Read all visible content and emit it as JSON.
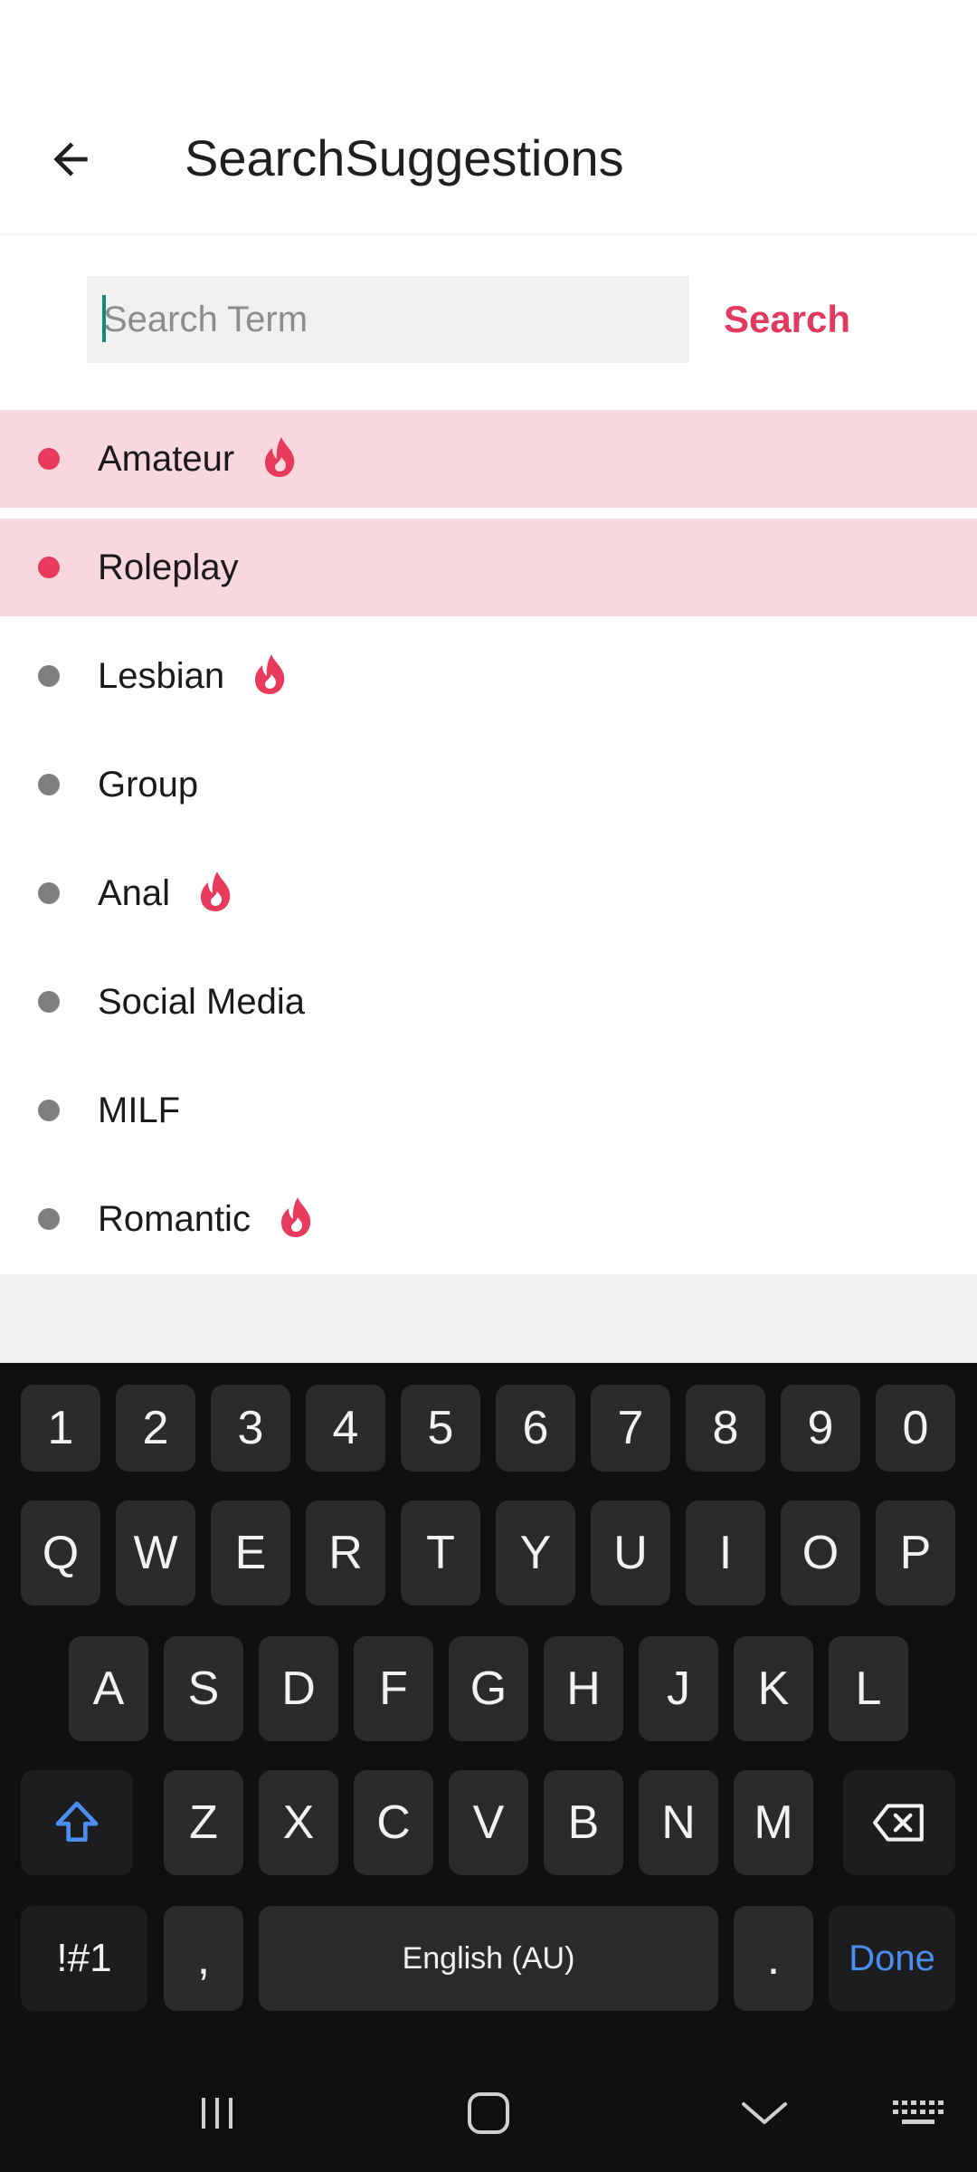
{
  "app": {
    "title": "SearchSuggestions"
  },
  "search": {
    "placeholder": "Search Term",
    "value": "",
    "button_label": "Search"
  },
  "suggestions": [
    {
      "label": "Amateur",
      "highlighted": true,
      "hot": true
    },
    {
      "label": "Roleplay",
      "highlighted": true,
      "hot": false
    },
    {
      "label": "Lesbian",
      "highlighted": false,
      "hot": true
    },
    {
      "label": "Group",
      "highlighted": false,
      "hot": false
    },
    {
      "label": "Anal",
      "highlighted": false,
      "hot": true
    },
    {
      "label": "Social Media",
      "highlighted": false,
      "hot": false
    },
    {
      "label": "MILF",
      "highlighted": false,
      "hot": false
    },
    {
      "label": "Romantic",
      "highlighted": false,
      "hot": true
    }
  ],
  "colors": {
    "accent": "#e23a5e",
    "highlight_bg": "#f9d7de",
    "keyboard_bg": "#0f0f0f",
    "key_bg": "#2b2b2d",
    "done_blue": "#4a8ef0"
  },
  "keyboard": {
    "row_numbers": [
      "1",
      "2",
      "3",
      "4",
      "5",
      "6",
      "7",
      "8",
      "9",
      "0"
    ],
    "row_top": [
      "Q",
      "W",
      "E",
      "R",
      "T",
      "Y",
      "U",
      "I",
      "O",
      "P"
    ],
    "row_middle": [
      "A",
      "S",
      "D",
      "F",
      "G",
      "H",
      "J",
      "K",
      "L"
    ],
    "row_bottom": [
      "Z",
      "X",
      "C",
      "V",
      "B",
      "N",
      "M"
    ],
    "symbols_label": "!#1",
    "comma_label": ",",
    "space_label": "English (AU)",
    "period_label": ".",
    "done_label": "Done",
    "shift_icon": "shift-icon",
    "backspace_icon": "backspace-icon"
  },
  "nav": {
    "recents_icon": "recents-icon",
    "home_icon": "home-icon",
    "back_icon": "chevron-down-icon",
    "keyboard_icon": "keyboard-icon"
  }
}
